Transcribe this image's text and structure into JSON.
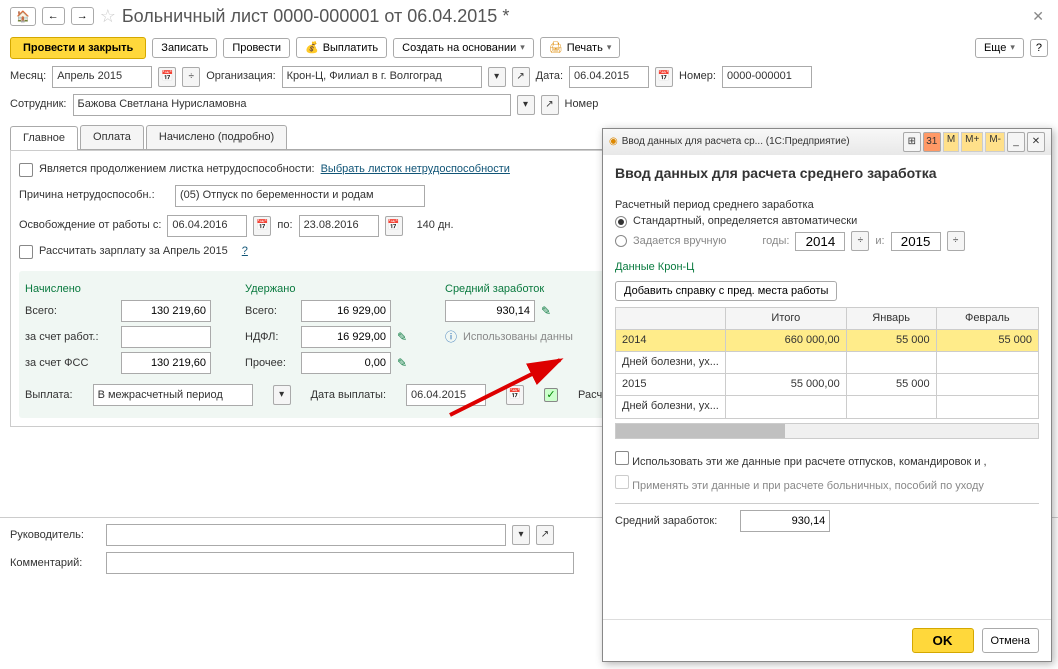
{
  "title": "Больничный лист 0000-000001 от 06.04.2015 *",
  "toolbar": {
    "save_close": "Провести и закрыть",
    "write": "Записать",
    "post": "Провести",
    "pay": "Выплатить",
    "create": "Создать на основании",
    "print": "Печать",
    "more": "Еще"
  },
  "fields": {
    "month_label": "Месяц:",
    "month": "Апрель 2015",
    "org_label": "Организация:",
    "org": "Крон-Ц, Филиал в г. Волгоград",
    "date_label": "Дата:",
    "date": "06.04.2015",
    "number_label": "Номер:",
    "number": "0000-000001",
    "employee_label": "Сотрудник:",
    "employee": "Бажова Светлана Нурисламовна",
    "number2_label": "Номер"
  },
  "tabs": [
    "Главное",
    "Оплата",
    "Начислено (подробно)"
  ],
  "main": {
    "continuation": "Является продолжением листка нетрудоспособности:",
    "select_sheet": "Выбрать листок нетрудоспособности",
    "cause_label": "Причина нетрудоспособн.:",
    "cause": "(05) Отпуск по беременности и родам",
    "release_label": "Освобождение от работы с:",
    "release_from": "06.04.2016",
    "to": "по:",
    "release_to": "23.08.2016",
    "days": "140 дн.",
    "calc_salary": "Рассчитать зарплату за Апрель 2015",
    "q": "?"
  },
  "calc": {
    "accrued_header": "Начислено",
    "withheld_header": "Удержано",
    "average_header": "Средний заработок",
    "total": "Всего:",
    "employer": "за счет работ.:",
    "fss": "за счет ФСС",
    "ndfl": "НДФЛ:",
    "other": "Прочее:",
    "accrued_total": "130 219,60",
    "withheld_total": "16 929,00",
    "average_value": "930,14",
    "ndfl_value": "16 929,00",
    "fss_value": "130 219,60",
    "other_value": "0,00",
    "used_data": "Использованы данны",
    "payment_label": "Выплата:",
    "payment": "В межрасчетный период",
    "pay_date_label": "Дата выплаты:",
    "pay_date": "06.04.2015",
    "calc_label": "Расчет"
  },
  "bottom": {
    "leader": "Руководитель:",
    "comment": "Комментарий:"
  },
  "popup": {
    "breadcrumb": "Ввод данных для расчета ср... (1С:Предприятие)",
    "title": "Ввод данных для расчета среднего заработка",
    "period_label": "Расчетный период среднего заработка",
    "radio_auto": "Стандартный, определяется автоматически",
    "radio_manual": "Задается вручную",
    "years_label": "годы:",
    "year1": "2014",
    "year_and": "и:",
    "year2": "2015",
    "data_label": "Данные Крон-Ц",
    "add_ref": "Добавить справку с пред. места работы",
    "headers": [
      "",
      "Итого",
      "Январь",
      "Февраль"
    ],
    "rows": [
      [
        "2014",
        "660 000,00",
        "55 000",
        "55 000"
      ],
      [
        "Дней болезни, ух...",
        "",
        "",
        ""
      ],
      [
        "2015",
        "55 000,00",
        "55 000",
        ""
      ],
      [
        "Дней болезни, ух...",
        "",
        "",
        ""
      ]
    ],
    "use_same": "Использовать эти же данные при расчете отпусков, командировок и ,",
    "apply": "Применять эти данные и при расчете больничных, пособий по уходу",
    "avg_label": "Средний заработок:",
    "avg_value": "930,14",
    "ok": "OK",
    "cancel": "Отмена",
    "m_btns": [
      "M",
      "M+",
      "M-"
    ]
  }
}
